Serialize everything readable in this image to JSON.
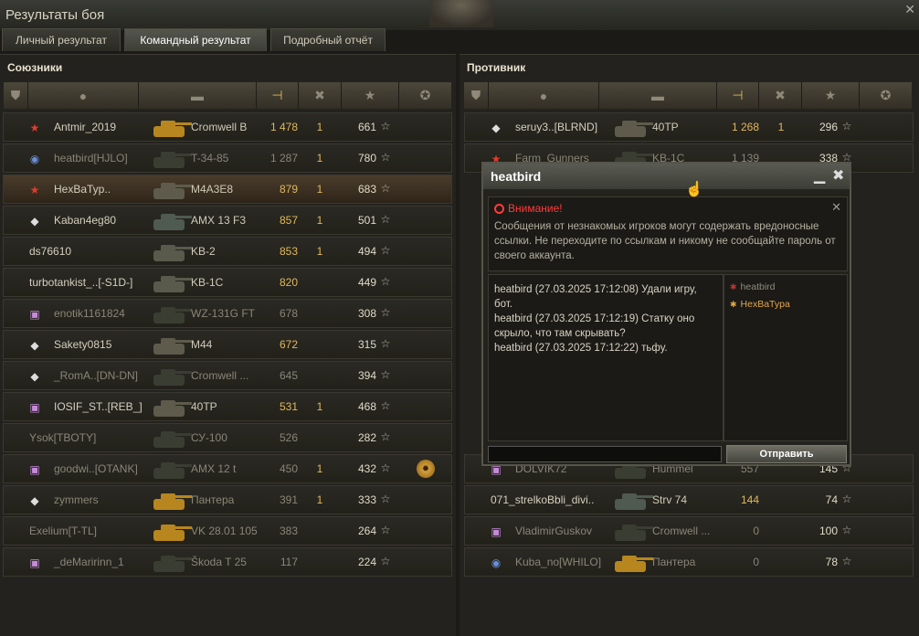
{
  "window": {
    "title": "Результаты боя"
  },
  "tabs": [
    "Личный результат",
    "Командный результат",
    "Подробный отчёт"
  ],
  "allies": {
    "title": "Союзники",
    "rows": [
      {
        "name": "Antmir_2019",
        "tank": "Cromwell B",
        "damage": "1 478",
        "kills": "1",
        "xp": "661",
        "badge": "star",
        "tank_color": "#b8861e",
        "hl": false,
        "dim": false,
        "medal": false
      },
      {
        "name": "heatbird[HJLO]",
        "tank": "T-34-85",
        "damage": "1 287",
        "kills": "1",
        "xp": "780",
        "badge": "ring",
        "tank_color": "#3a3d32",
        "hl": false,
        "dim": true,
        "medal": false
      },
      {
        "name": "HexBaTyp..",
        "tank": "M4A3E8",
        "damage": "879",
        "kills": "1",
        "xp": "683",
        "badge": "star",
        "tank_color": "#5e5b4c",
        "hl": true,
        "dim": false,
        "medal": false
      },
      {
        "name": "Kaban4eg80",
        "tank": "AMX 13 F3",
        "damage": "857",
        "kills": "1",
        "xp": "501",
        "badge": "diamond",
        "tank_color": "#4f5a50",
        "hl": false,
        "dim": false,
        "medal": false
      },
      {
        "name": "ds76610",
        "tank": "KB-2",
        "damage": "853",
        "kills": "1",
        "xp": "494",
        "badge": "",
        "tank_color": "#5a5a4c",
        "hl": false,
        "dim": false,
        "medal": false
      },
      {
        "name": "turbotankist_..[-S1D-]",
        "tank": "KB-1C",
        "damage": "820",
        "kills": "",
        "xp": "449",
        "badge": "",
        "tank_color": "#5a5a4c",
        "hl": false,
        "dim": false,
        "medal": false
      },
      {
        "name": "enotik1161824",
        "tank": "WZ-131G FT",
        "damage": "678",
        "kills": "",
        "xp": "308",
        "badge": "clan",
        "tank_color": "#3a3d32",
        "hl": false,
        "dim": true,
        "medal": false
      },
      {
        "name": "Sakety0815",
        "tank": "M44",
        "damage": "672",
        "kills": "",
        "xp": "315",
        "badge": "diamond",
        "tank_color": "#5e5b4c",
        "hl": false,
        "dim": false,
        "medal": false
      },
      {
        "name": "_RomA..[DN-DN]",
        "tank": "Cromwell ...",
        "damage": "645",
        "kills": "",
        "xp": "394",
        "badge": "diamond",
        "tank_color": "#3a3d32",
        "hl": false,
        "dim": true,
        "medal": false
      },
      {
        "name": "IOSIF_ST..[REB_]",
        "tank": "40TP",
        "damage": "531",
        "kills": "1",
        "xp": "468",
        "badge": "clan",
        "tank_color": "#5e5b4c",
        "hl": false,
        "dim": false,
        "medal": false
      },
      {
        "name": "Ysok[TBOTY]",
        "tank": "СУ-100",
        "damage": "526",
        "kills": "",
        "xp": "282",
        "badge": "",
        "tank_color": "#3a3d32",
        "hl": false,
        "dim": true,
        "medal": false
      },
      {
        "name": "goodwi..[OTANK]",
        "tank": "AMX 12 t",
        "damage": "450",
        "kills": "1",
        "xp": "432",
        "badge": "clan",
        "tank_color": "#3a3d32",
        "hl": false,
        "dim": true,
        "medal": true
      },
      {
        "name": "zymmers",
        "tank": "Пантера",
        "damage": "391",
        "kills": "1",
        "xp": "333",
        "badge": "diamond",
        "tank_color": "#b8861e",
        "hl": false,
        "dim": true,
        "medal": false
      },
      {
        "name": "Exelium[T-TL]",
        "tank": "VK 28.01 105",
        "damage": "383",
        "kills": "",
        "xp": "264",
        "badge": "",
        "tank_color": "#b8861e",
        "hl": false,
        "dim": true,
        "medal": false
      },
      {
        "name": "_deMaririnn_1",
        "tank": "Škoda T 25",
        "damage": "117",
        "kills": "",
        "xp": "224",
        "badge": "clan",
        "tank_color": "#3a3d32",
        "hl": false,
        "dim": true,
        "medal": false
      }
    ]
  },
  "enemies": {
    "title": "Противник",
    "rows": [
      {
        "name": "seruy3..[BLRND]",
        "tank": "40TP",
        "damage": "1 268",
        "kills": "1",
        "xp": "296",
        "badge": "diamond",
        "tank_color": "#5e5b4c",
        "hl": false,
        "dim": false,
        "medal": false
      },
      {
        "name": "Farm_Gunners",
        "tank": "KB-1C",
        "damage": "1 139",
        "kills": "",
        "xp": "338",
        "badge": "star",
        "tank_color": "#3a3d32",
        "hl": false,
        "dim": true,
        "medal": false
      }
    ],
    "bottom_rows": [
      {
        "name": "DOLVIK72",
        "tank": "Hummel",
        "damage": "557",
        "kills": "",
        "xp": "145",
        "badge": "clan",
        "tank_color": "#3a3d32",
        "hl": false,
        "dim": true,
        "medal": false
      },
      {
        "name": "071_strelkoBbli_divi..",
        "tank": "Strv 74",
        "damage": "144",
        "kills": "",
        "xp": "74",
        "badge": "",
        "tank_color": "#4f5a50",
        "hl": false,
        "dim": false,
        "medal": false
      },
      {
        "name": "VladimirGuskov",
        "tank": "Cromwell ...",
        "damage": "0",
        "kills": "",
        "xp": "100",
        "badge": "clan",
        "tank_color": "#3a3d32",
        "hl": false,
        "dim": true,
        "medal": false
      },
      {
        "name": "Kuba_no[WHILO]",
        "tank": "Пантера",
        "damage": "0",
        "kills": "",
        "xp": "78",
        "badge": "ring",
        "tank_color": "#b8861e",
        "hl": false,
        "dim": true,
        "medal": false
      }
    ]
  },
  "chat": {
    "title": "heatbird",
    "warning_title": "Внимание!",
    "warning_text": "Сообщения от незнакомых игроков могут содержать вредоносные ссылки. Не переходите по ссылкам и никому не сообщайте пароль от своего аккаунта.",
    "messages": [
      "heatbird (27.03.2025 17:12:08) Удали игру, бот.",
      "heatbird (27.03.2025 17:12:19) Статку оно скрыло, что там скрывать?",
      "heatbird (27.03.2025 17:12:22) тьфу."
    ],
    "members": [
      {
        "name": "heatbird",
        "color": "#8f8a7c",
        "dot_color": "#c0332a"
      },
      {
        "name": "HexBaTypa",
        "color": "#e3a64a",
        "dot_color": "#e3a64a"
      }
    ],
    "send_label": "Отправить",
    "input_value": ""
  },
  "colors": {
    "damage_active": "#e1b85a",
    "damage_dim": "#8a8577"
  }
}
